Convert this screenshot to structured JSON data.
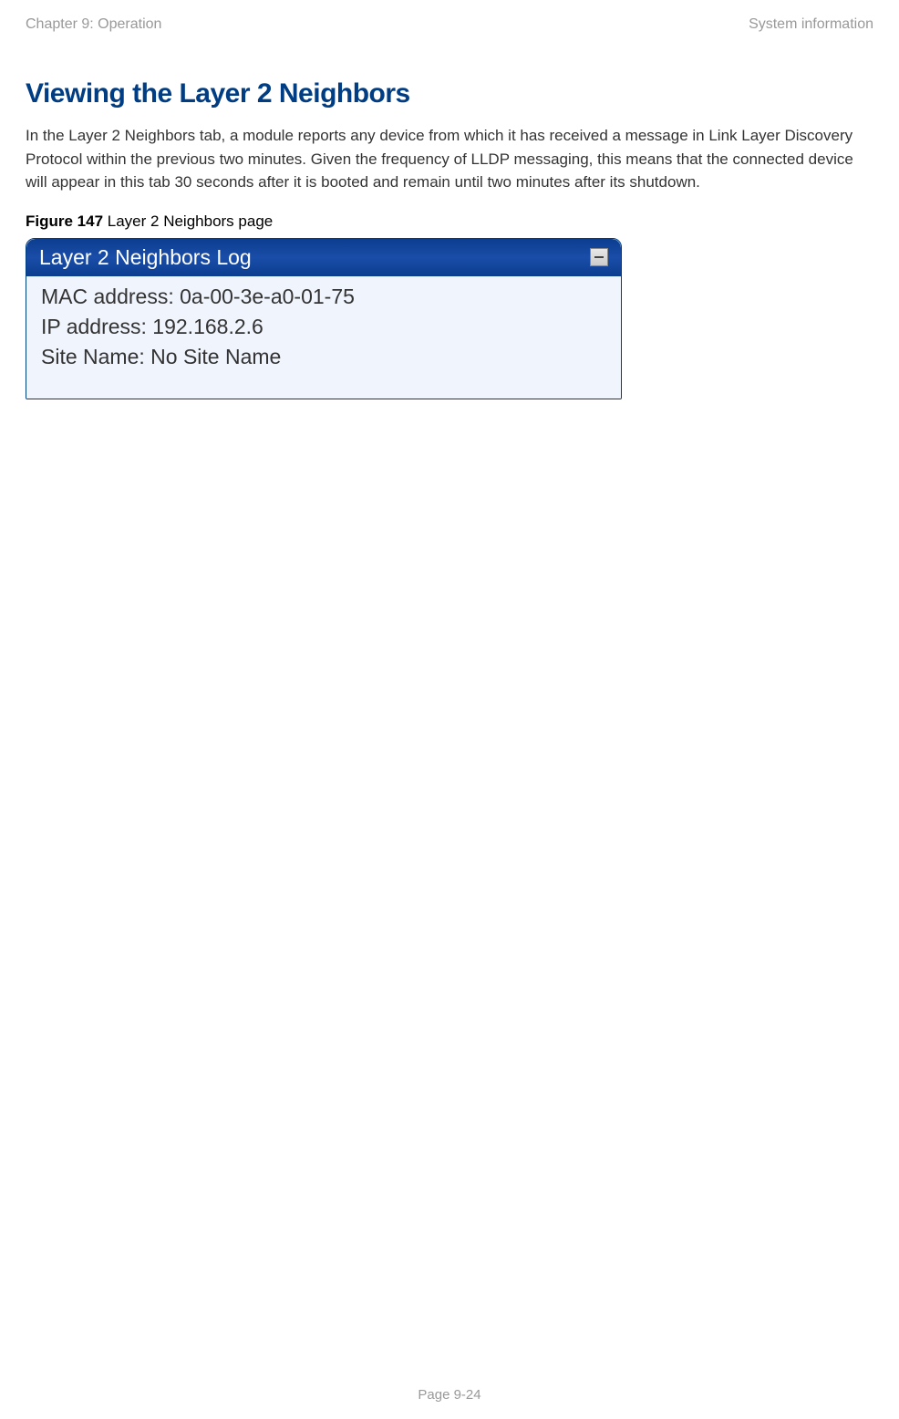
{
  "header": {
    "left": "Chapter 9:  Operation",
    "right": "System information"
  },
  "section": {
    "title": "Viewing the Layer 2 Neighbors",
    "body": "In the Layer 2 Neighbors tab, a module reports any device from which it has received a message in Link Layer Discovery Protocol within the previous two minutes. Given the frequency of LLDP messaging, this means that the connected device will appear in this tab 30 seconds after it is booted and remain until two minutes after its shutdown."
  },
  "figure": {
    "label_bold": "Figure 147",
    "label_rest": " Layer 2 Neighbors page",
    "panel_title": "Layer 2 Neighbors Log",
    "rows": [
      "MAC address:  0a-00-3e-a0-01-75",
      "IP address:  192.168.2.6",
      "Site Name:  No Site Name"
    ]
  },
  "footer": {
    "page": "Page 9-24"
  }
}
